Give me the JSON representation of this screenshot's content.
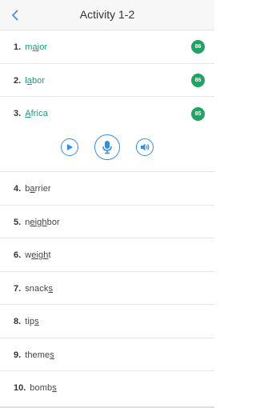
{
  "header": {
    "title": "Activity 1-2",
    "back_icon": "chevron-left-icon"
  },
  "colors": {
    "accent": "#2f8ee8",
    "score_badge": "#22a366",
    "active_word": "#1a9c7a"
  },
  "items": [
    {
      "num": "1.",
      "pre": "m",
      "ul": "a",
      "post": "jor",
      "score": "86",
      "active": true
    },
    {
      "num": "2.",
      "pre": "l",
      "ul": "a",
      "post": "bor",
      "score": "86",
      "active": true
    },
    {
      "num": "3.",
      "pre": "",
      "ul": "A",
      "post": "frica",
      "score": "85",
      "active": true,
      "expanded": true
    },
    {
      "num": "4.",
      "pre": "b",
      "ul": "a",
      "post": "rrier"
    },
    {
      "num": "5.",
      "pre": "n",
      "ul": "eigh",
      "post": "bor"
    },
    {
      "num": "6.",
      "pre": "w",
      "ul": "eigh",
      "post": "t"
    },
    {
      "num": "7.",
      "pre": "snack",
      "ul": "s",
      "post": ""
    },
    {
      "num": "8.",
      "pre": "tip",
      "ul": "s",
      "post": ""
    },
    {
      "num": "9.",
      "pre": "theme",
      "ul": "s",
      "post": ""
    },
    {
      "num": "10.",
      "pre": "bomb",
      "ul": "s",
      "post": ""
    }
  ],
  "controls": {
    "play_icon": "play-icon",
    "mic_icon": "microphone-icon",
    "speaker_icon": "speaker-icon"
  }
}
